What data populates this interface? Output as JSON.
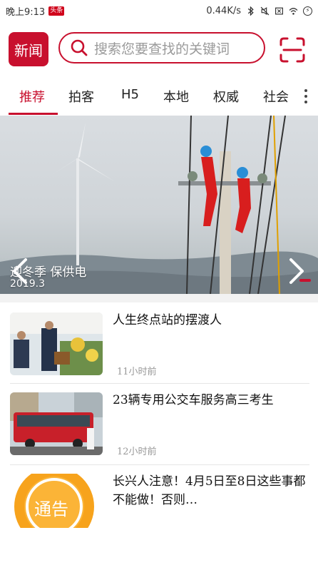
{
  "status_bar": {
    "time": "晚上9:13",
    "app_badge": "头条",
    "network_speed": "0.44K/s"
  },
  "header": {
    "logo_text": "新闻",
    "search_placeholder": "搜索您要查找的关键词"
  },
  "tabs": [
    "推荐",
    "拍客",
    "H5",
    "本地",
    "权威",
    "社会"
  ],
  "active_tab_index": 0,
  "banner": {
    "caption": "迎冬季 保供电",
    "date": "2019.3",
    "slide_count": 1
  },
  "news": [
    {
      "title": "人生终点站的摆渡人",
      "time": "11小时前",
      "thumb": "funeral-service-photo"
    },
    {
      "title": "23辆专用公交车服务高三考生",
      "time": "12小时前",
      "thumb": "bus-photo"
    },
    {
      "title": "长兴人注意！4月5日至8日这些事都不能做！否则…",
      "time": "",
      "thumb": "notice-icon",
      "thumb_text": "通告"
    }
  ],
  "colors": {
    "accent": "#c8102e",
    "placeholder": "#9a9a9a",
    "time": "#999999"
  }
}
